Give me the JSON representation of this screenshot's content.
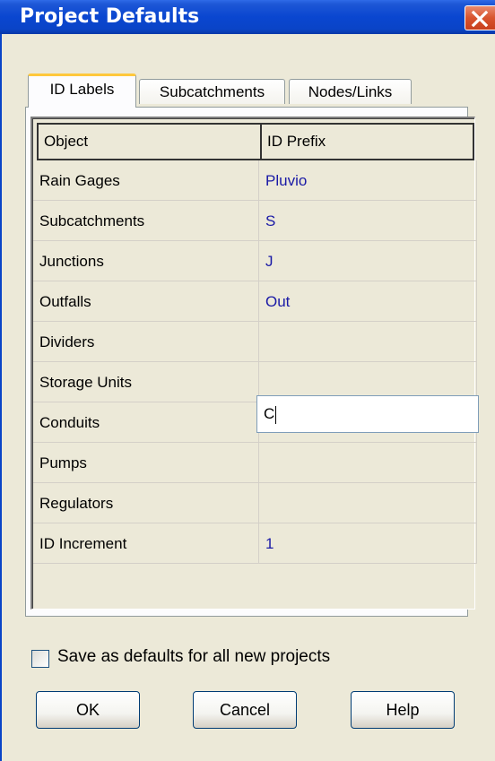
{
  "window": {
    "title": "Project Defaults"
  },
  "tabs": [
    {
      "label": "ID Labels"
    },
    {
      "label": "Subcatchments"
    },
    {
      "label": "Nodes/Links"
    }
  ],
  "grid": {
    "headers": {
      "object": "Object",
      "prefix": "ID Prefix"
    },
    "rows": [
      {
        "object": "Rain Gages",
        "prefix": "Pluvio"
      },
      {
        "object": "Subcatchments",
        "prefix": "S"
      },
      {
        "object": "Junctions",
        "prefix": "J"
      },
      {
        "object": "Outfalls",
        "prefix": "Out"
      },
      {
        "object": "Dividers",
        "prefix": ""
      },
      {
        "object": "Storage Units",
        "prefix": ""
      },
      {
        "object": "Conduits",
        "prefix": "C"
      },
      {
        "object": "Pumps",
        "prefix": ""
      },
      {
        "object": "Regulators",
        "prefix": ""
      },
      {
        "object": "ID Increment",
        "prefix": "1"
      }
    ]
  },
  "save_defaults": {
    "label": "Save as defaults for all new projects",
    "checked": false
  },
  "buttons": {
    "ok": "OK",
    "cancel": "Cancel",
    "help": "Help"
  },
  "colors": {
    "titlebar": "#0a44c7",
    "value_text": "#1a1aa6",
    "dialog_bg": "#ece9d8",
    "close_red": "#d8542e"
  }
}
